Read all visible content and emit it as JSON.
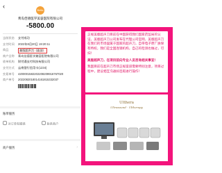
{
  "left_panel": {
    "back_icon": "chevron-left-icon",
    "merchant_logo_text": "Bella",
    "merchant_name": "青岛佳德医学美容医院有限公司",
    "amount": "-5800.00",
    "details": [
      {
        "label": "当前状态",
        "value": "支付成功"
      },
      {
        "label": "支付时间",
        "value": "2022年8月20日 19:20:11"
      },
      {
        "label": "商品",
        "value": "美版超声刀（面部）",
        "highlight": true
      },
      {
        "label": "商户全称",
        "value": "青岛佳德医学美容医院有限公司"
      },
      {
        "label": "收单机构",
        "value": "财付通支付科技有限公司"
      },
      {
        "label": "支付方式",
        "value": "云南银行信用卡(1234)"
      },
      {
        "label": "交易单号",
        "value": "4200001582202208209916767020"
      },
      {
        "label": "商户单号",
        "value": "2022082018014161815332037"
      }
    ],
    "barcode_label": "",
    "bill_section": {
      "title": "账单服务",
      "links": [
        {
          "icon": "question-circle-icon",
          "label": "对订单有疑惑"
        },
        {
          "icon": "store-icon",
          "label": "联系商户"
        }
      ]
    },
    "footer_section": {
      "title": "商户服务"
    }
  },
  "right_panel": {
    "accent_color": "#f3147c",
    "notice_paragraphs": [
      {
        "text": "正规美版超声刀目前在中国获得我们国家药监局的认证，美版超声刀公司发布在代理公司官网，美版超声刀在我们的市场里属于国家的超声刀，自带电子原厂质保有特权，我们是全国连锁机构，自己的检测也做过，可扫！",
        "bold": false
      },
      {
        "text": "美版超声刀，在项目前向专业人员咨询相关事宜！",
        "bold": true
      },
      {
        "text": "我国目前在超声刀市场正规渠道需要特别注意，项目过程中，建议相互沟通好后再进行操作！",
        "bold": false
      }
    ],
    "brand_name": "Ulthera",
    "brand_tagline": "Ultrasound · Ultherapy"
  }
}
